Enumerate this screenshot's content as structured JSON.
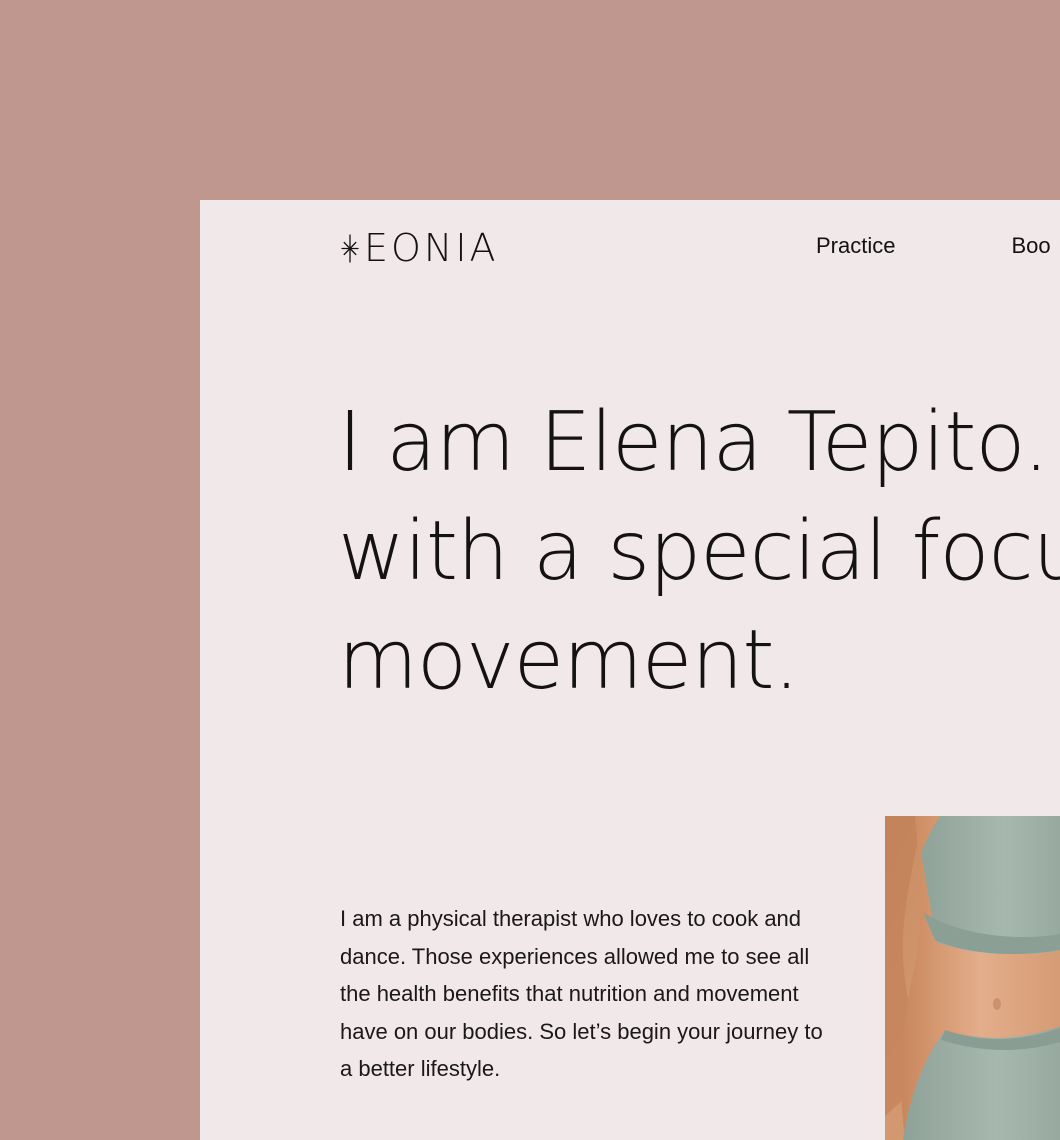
{
  "brand": {
    "logo_text": "EONIA",
    "logo_icon": "sparkle-star-icon"
  },
  "nav": {
    "items": [
      {
        "label": "Practice"
      },
      {
        "label": "Boo"
      }
    ]
  },
  "hero": {
    "headline": "I am Elena Tepito. F\nwith a special focu\nmovement.",
    "intro": "I am a physical therapist who loves to cook and dance. Those experiences allowed me to see all the health benefits that nutrition and movement have on our bodies. So let’s begin your journey to a better lifestyle."
  },
  "colors": {
    "backdrop": "#bf978e",
    "page_background": "#f1e9e9",
    "text": "#141212",
    "photo_skin": "#d39a71",
    "photo_garment": "#9fb0a7"
  },
  "images": {
    "hero_photo": "woman-in-sage-sports-bra-photo"
  }
}
